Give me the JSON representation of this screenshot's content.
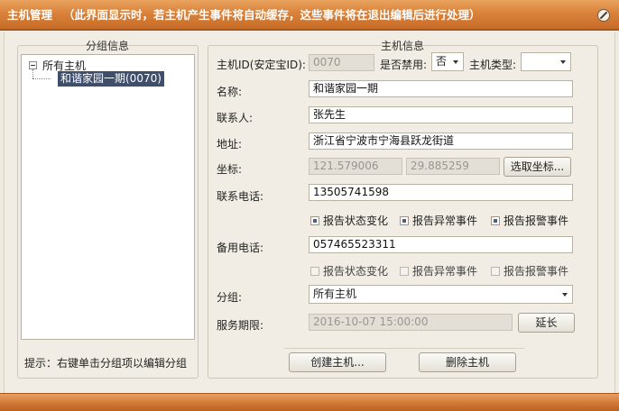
{
  "window": {
    "title": "主机管理",
    "hint": "（此界面显示时，若主机产生事件将自动缓存，这些事件将在退出编辑后进行处理）",
    "close_icon": "close-icon"
  },
  "group_panel": {
    "title": "分组信息",
    "tree": {
      "root_label": "所有主机",
      "children": [
        "和谐家园一期(0070)"
      ]
    },
    "tip": "提示：右键单击分组项以编辑分组"
  },
  "info_panel": {
    "title": "主机信息",
    "host_id": {
      "label": "主机ID(安定宝ID):",
      "value": "0070"
    },
    "disabled": {
      "label": "是否禁用:",
      "value": "否"
    },
    "host_type": {
      "label": "主机类型:",
      "value": ""
    },
    "name": {
      "label": "名称:",
      "value": "和谐家园一期"
    },
    "contact": {
      "label": "联系人:",
      "value": "张先生"
    },
    "address": {
      "label": "地址:",
      "value": "浙江省宁波市宁海县跃龙街道"
    },
    "coords": {
      "label": "坐标:",
      "lon": "121.579006",
      "lat": "29.885259",
      "button": "选取坐标..."
    },
    "phone": {
      "label": "联系电话:",
      "value": "13505741598",
      "checks": [
        {
          "label": "报告状态变化",
          "checked": true
        },
        {
          "label": "报告异常事件",
          "checked": true
        },
        {
          "label": "报告报警事件",
          "checked": true
        }
      ]
    },
    "backup_phone": {
      "label": "备用电话:",
      "value": "057465523311",
      "checks": [
        {
          "label": "报告状态变化",
          "checked": false
        },
        {
          "label": "报告异常事件",
          "checked": false
        },
        {
          "label": "报告报警事件",
          "checked": false
        }
      ]
    },
    "group": {
      "label": "分组:",
      "value": "所有主机"
    },
    "service": {
      "label": "服务期限:",
      "value": "2016-10-07 15:00:00",
      "button": "延长"
    }
  },
  "actions": {
    "create": "创建主机...",
    "delete": "删除主机"
  }
}
